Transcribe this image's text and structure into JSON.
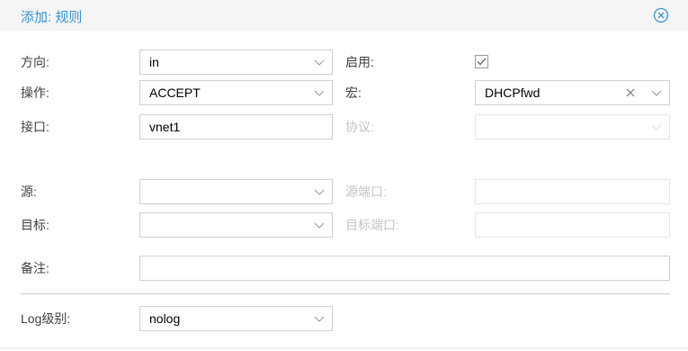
{
  "dialog": {
    "title": "添加: 规则"
  },
  "form": {
    "direction": {
      "label": "方向:",
      "value": "in"
    },
    "enable": {
      "label": "启用:",
      "checked": true
    },
    "action": {
      "label": "操作:",
      "value": "ACCEPT"
    },
    "macro": {
      "label": "宏:",
      "value": "DHCPfwd"
    },
    "interface": {
      "label": "接口:",
      "value": "vnet1"
    },
    "protocol": {
      "label": "协议:",
      "value": "",
      "disabled": true
    },
    "source": {
      "label": "源:",
      "value": ""
    },
    "source_port": {
      "label": "源端口:",
      "value": "",
      "disabled": true
    },
    "destination": {
      "label": "目标:",
      "value": ""
    },
    "dest_port": {
      "label": "目标端口:",
      "value": "",
      "disabled": true
    },
    "comment": {
      "label": "备注:",
      "value": ""
    },
    "log_level": {
      "label": "Log级别:",
      "value": "nolog"
    }
  },
  "icons": {
    "close": "close-circle-icon",
    "chevron": "chevron-down-icon",
    "clear": "clear-x-icon",
    "checkbox": "checkbox-checked-icon"
  },
  "colors": {
    "accent": "#3892d4",
    "border": "#cfcfcf",
    "disabled": "#c4c4c4"
  }
}
